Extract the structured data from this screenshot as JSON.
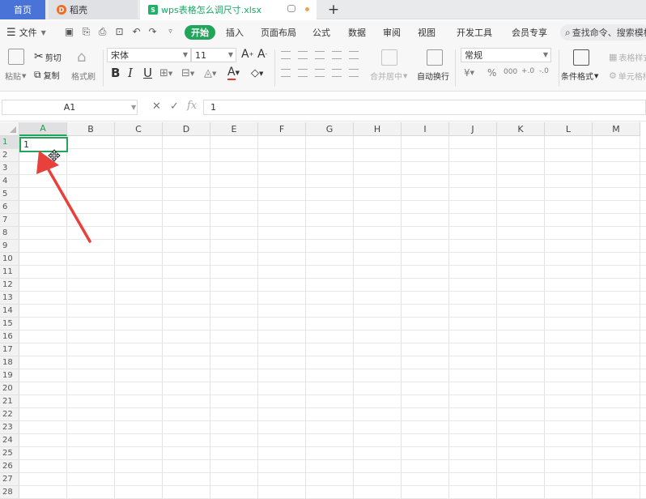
{
  "tabs": [
    {
      "label": "首页"
    },
    {
      "label": "稻壳"
    },
    {
      "label": "wps表格怎么调尺寸.xlsx"
    }
  ],
  "menu": {
    "file": "文件",
    "items": [
      "开始",
      "插入",
      "页面布局",
      "公式",
      "数据",
      "审阅",
      "视图",
      "开发工具",
      "会员专享"
    ],
    "search": "查找命令、搜索模板"
  },
  "ribbon": {
    "paste": "粘贴",
    "cut": "剪切",
    "copy": "复制",
    "format_painter": "格式刷",
    "font_name": "宋体",
    "font_size": "11",
    "merge_center": "合并居中",
    "wrap_text": "自动换行",
    "number_format": "常规",
    "conditional_format": "条件格式",
    "table_style": "表格样式",
    "cell_style": "单元格样式"
  },
  "formula_bar": {
    "name_box": "A1",
    "value": "1"
  },
  "grid": {
    "columns": [
      "A",
      "B",
      "C",
      "D",
      "E",
      "F",
      "G",
      "H",
      "I",
      "J",
      "K",
      "L",
      "M"
    ],
    "rows": [
      "1",
      "2",
      "3",
      "4",
      "5",
      "6",
      "7",
      "8",
      "9",
      "10",
      "11",
      "12",
      "13",
      "14",
      "15",
      "16",
      "17",
      "18",
      "19",
      "20",
      "21",
      "22",
      "23",
      "24",
      "25",
      "26",
      "27",
      "28"
    ],
    "active_cell": "A1",
    "active_cell_value": "1"
  },
  "colors": {
    "accent_green": "#22a45a",
    "home_tab_blue": "#4a73d8",
    "annotation_arrow": "#e8403a"
  }
}
